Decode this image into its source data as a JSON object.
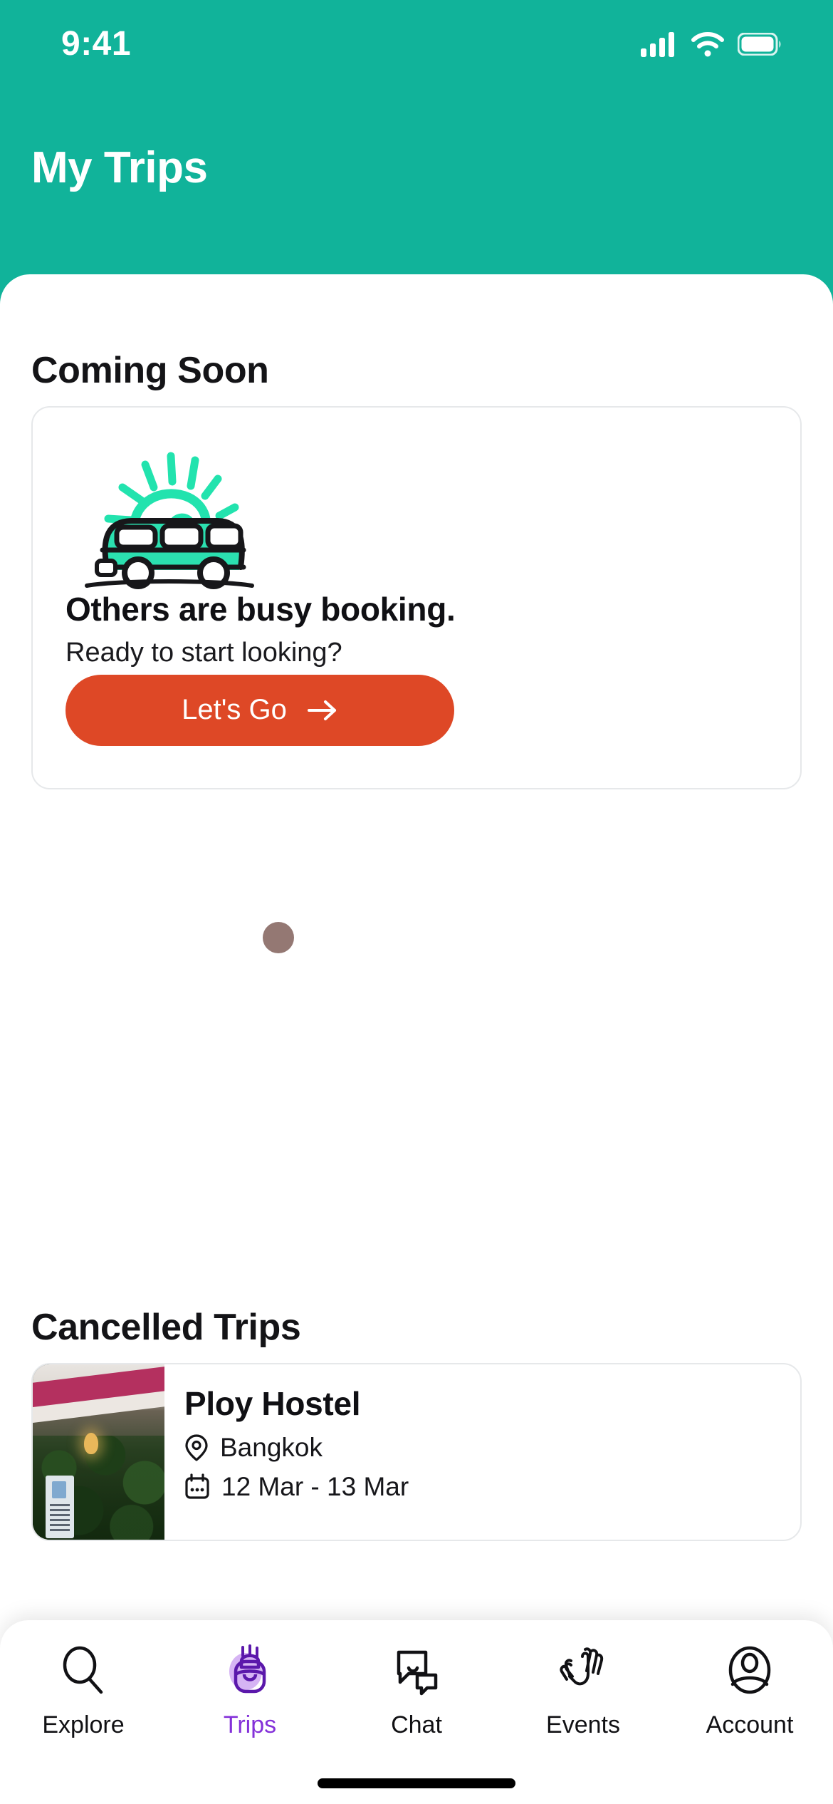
{
  "status_bar": {
    "time": "9:41",
    "cellular_icon": "cellular-signal-icon",
    "wifi_icon": "wifi-icon",
    "battery_icon": "battery-full-icon"
  },
  "header": {
    "title": "My Trips",
    "background_color": "#11B39A"
  },
  "coming_soon": {
    "section_title": "Coming Soon",
    "empty_state": {
      "illustration": "camper-van-with-sun-illustration",
      "heading": "Others are busy booking.",
      "subtext": "Ready to start looking?",
      "cta_label": "Let's Go",
      "cta_icon": "arrow-right-icon",
      "cta_color": "#DE4826"
    }
  },
  "cancelled_trips": {
    "section_title": "Cancelled Trips",
    "items": [
      {
        "name": "Ploy Hostel",
        "location_icon": "location-pin-icon",
        "location": "Bangkok",
        "date_icon": "calendar-icon",
        "dates": "12 Mar - 13 Mar",
        "thumbnail": "hostel-garden-photo"
      }
    ]
  },
  "bottom_nav": {
    "active_color": "#8431D9",
    "items": [
      {
        "label": "Explore",
        "icon": "search-icon",
        "active": false
      },
      {
        "label": "Trips",
        "icon": "backpack-icon",
        "active": true
      },
      {
        "label": "Chat",
        "icon": "chat-bubbles-icon",
        "active": false
      },
      {
        "label": "Events",
        "icon": "waving-hands-icon",
        "active": false
      },
      {
        "label": "Account",
        "icon": "user-circle-icon",
        "active": false
      }
    ]
  },
  "home_indicator": "home-indicator-bar"
}
